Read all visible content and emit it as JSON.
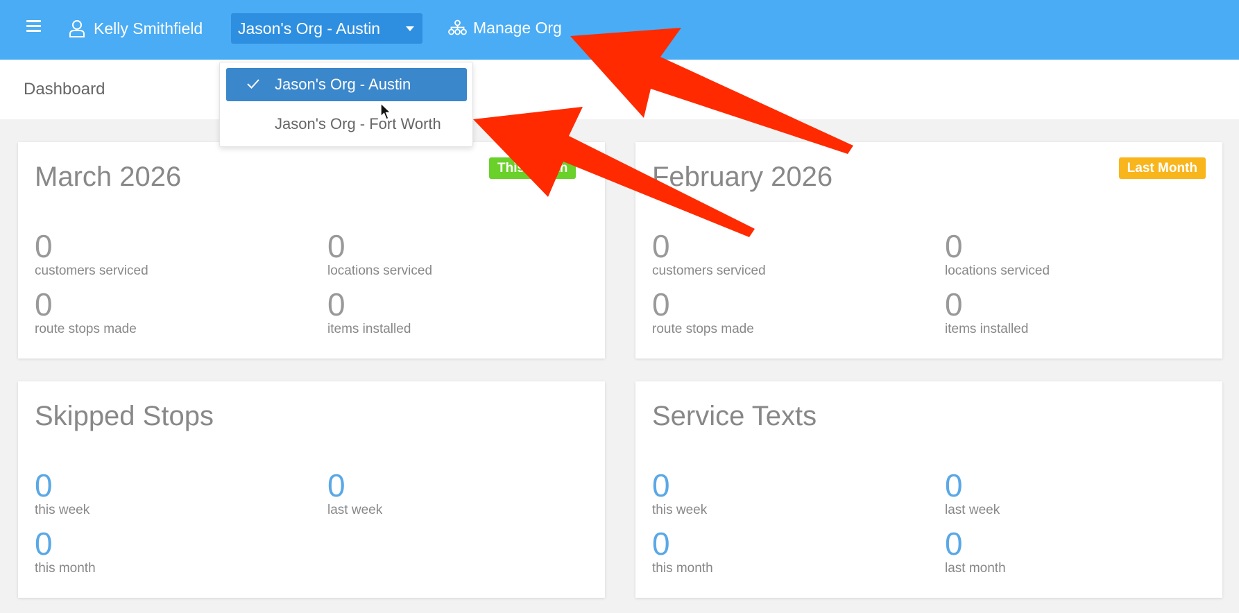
{
  "topbar": {
    "user_name": "Kelly Smithfield",
    "org_selected": "Jason's Org - Austin",
    "manage_org": "Manage Org"
  },
  "breadcrumb": "Dashboard",
  "org_dropdown": {
    "options": [
      {
        "label": "Jason's Org - Austin",
        "selected": true
      },
      {
        "label": "Jason's Org - Fort Worth",
        "selected": false
      }
    ]
  },
  "cards": {
    "current_month": {
      "title": "March 2026",
      "badge": "This Month",
      "stats": [
        {
          "value": "0",
          "label": "customers serviced"
        },
        {
          "value": "0",
          "label": "locations serviced"
        },
        {
          "value": "0",
          "label": "route stops made"
        },
        {
          "value": "0",
          "label": "items installed"
        }
      ]
    },
    "last_month": {
      "title": "February 2026",
      "badge": "Last Month",
      "stats": [
        {
          "value": "0",
          "label": "customers serviced"
        },
        {
          "value": "0",
          "label": "locations serviced"
        },
        {
          "value": "0",
          "label": "route stops made"
        },
        {
          "value": "0",
          "label": "items installed"
        }
      ]
    },
    "skipped_stops": {
      "title": "Skipped Stops",
      "stats": [
        {
          "value": "0",
          "label": "this week"
        },
        {
          "value": "0",
          "label": "last week"
        },
        {
          "value": "0",
          "label": "this month"
        }
      ]
    },
    "service_texts": {
      "title": "Service Texts",
      "stats": [
        {
          "value": "0",
          "label": "this week"
        },
        {
          "value": "0",
          "label": "last week"
        },
        {
          "value": "0",
          "label": "this month"
        },
        {
          "value": "0",
          "label": "last month"
        }
      ]
    }
  },
  "colors": {
    "topbar": "#4aacf4",
    "select": "#2e8fe0",
    "selected_option": "#3b87cb",
    "badge_this_month": "#6ad02a",
    "badge_last_month": "#f8b51c",
    "stat_blue": "#5aa8e6",
    "annotation_arrow": "#ff2a00"
  },
  "icons": [
    "menu-icon",
    "user-icon",
    "caret-down-icon",
    "org-tree-icon",
    "check-icon",
    "mouse-cursor-icon"
  ]
}
